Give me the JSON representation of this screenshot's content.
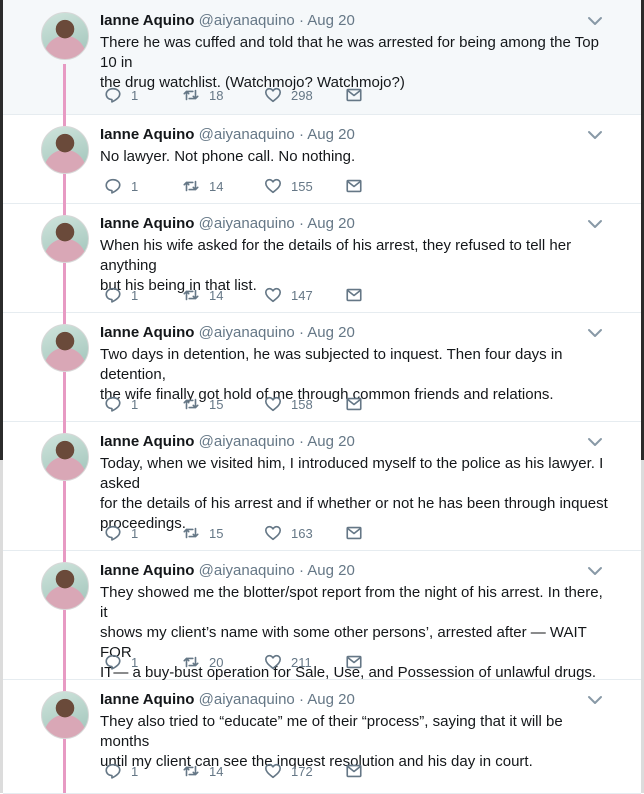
{
  "thread": {
    "author_name": "Ianne Aquino",
    "author_handle": "@aiyanaquino",
    "tweets": [
      {
        "date": "Aug 20",
        "text": "There he was cuffed and told that he was arrested for being among the Top 10 in\nthe drug watchlist. (Watchmojo? Watchmojo?)",
        "replies": "1",
        "retweets": "18",
        "likes": "298"
      },
      {
        "date": "Aug 20",
        "text": "No lawyer. Not phone call. No nothing.",
        "replies": "1",
        "retweets": "14",
        "likes": "155"
      },
      {
        "date": "Aug 20",
        "text": "When his wife asked for the details of his arrest, they refused to tell her anything\nbut his being in that list.",
        "replies": "1",
        "retweets": "14",
        "likes": "147"
      },
      {
        "date": "Aug 20",
        "text": "Two days in detention, he was subjected to inquest. Then four days in detention,\nthe wife finally got hold of me through common friends and relations.",
        "replies": "1",
        "retweets": "15",
        "likes": "158"
      },
      {
        "date": "Aug 20",
        "text": "Today, when we visited him, I introduced myself to the police as his lawyer. I asked\nfor the details of his arrest and if whether or not he has been through inquest\nproceedings.",
        "replies": "1",
        "retweets": "15",
        "likes": "163"
      },
      {
        "date": "Aug 20",
        "text": "They showed me the blotter/spot report from the night of his arrest. In there, it\nshows my client’s name with some other persons’, arrested after — WAIT FOR\nIT— a buy-bust operation for Sale, Use, and Possession of unlawful drugs.",
        "replies": "1",
        "retweets": "20",
        "likes": "211"
      },
      {
        "date": "Aug 20",
        "text": "They also tried to “educate” me of their “process”, saying that it will be months\nuntil my client can see the inquest resolution and his day in court.",
        "replies": "1",
        "retweets": "14",
        "likes": "172"
      }
    ]
  },
  "colors": {
    "thread_line": "#e79ac3",
    "secondary_text": "#657786",
    "first_tweet_bg": "#f5f8fa"
  }
}
